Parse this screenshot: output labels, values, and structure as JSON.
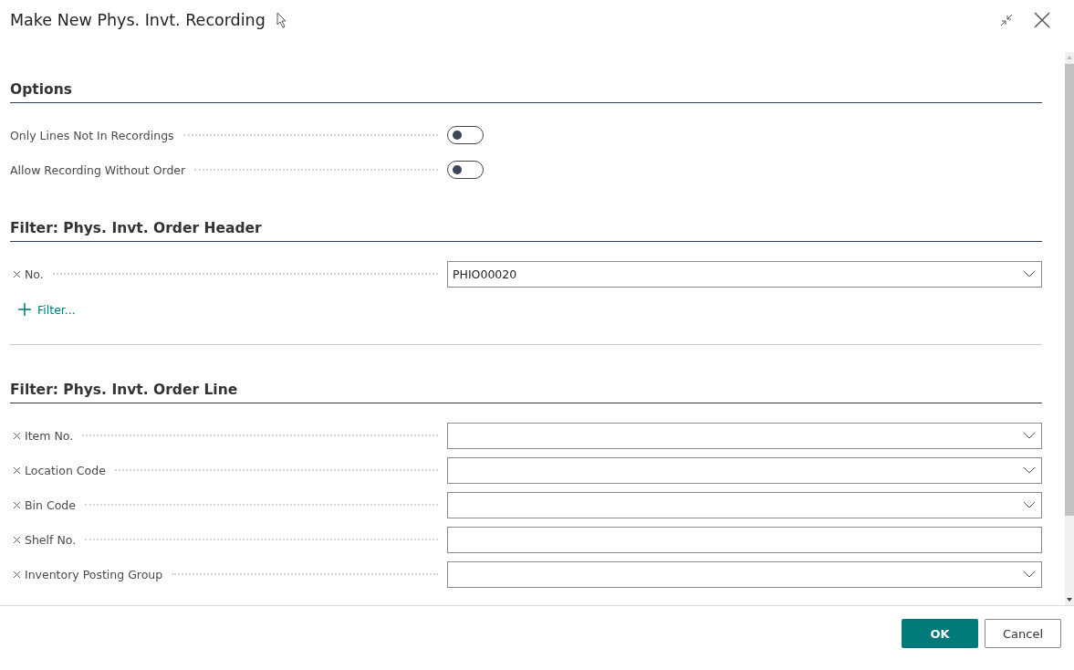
{
  "dialog": {
    "title": "Make New Phys. Invt. Recording"
  },
  "sections": [
    {
      "title": "Options",
      "rows": [
        {
          "kind": "toggle",
          "label": "Only Lines Not In Recordings",
          "on": false
        },
        {
          "kind": "toggle",
          "label": "Allow Recording Without Order",
          "on": false
        }
      ]
    },
    {
      "title": "Filter: Phys. Invt. Order Header",
      "rows": [
        {
          "kind": "dropdown",
          "label": "No.",
          "value": "PHIO00020"
        }
      ],
      "add_filter": "Filter..."
    },
    {
      "title": "Filter: Phys. Invt. Order Line",
      "rows": [
        {
          "kind": "dropdown",
          "label": "Item No."
        },
        {
          "kind": "dropdown",
          "label": "Location Code"
        },
        {
          "kind": "dropdown",
          "label": "Bin Code"
        },
        {
          "kind": "text",
          "label": "Shelf No."
        },
        {
          "kind": "dropdown",
          "label": "Inventory Posting Group"
        }
      ]
    }
  ],
  "buttons": [
    {
      "label": "OK",
      "kind": "primary"
    },
    {
      "label": "Cancel",
      "kind": "secondary"
    }
  ]
}
